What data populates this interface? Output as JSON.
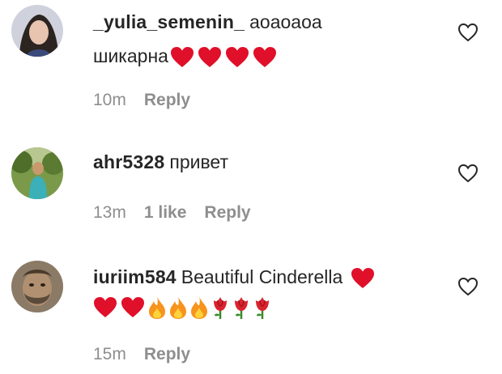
{
  "comments": [
    {
      "username": "_yulia_semenin_",
      "text_line1": "аоаоаоа",
      "text_line2": "шикарна",
      "emoji_line1": [],
      "emoji_line2": [
        "red-heart",
        "red-heart",
        "red-heart",
        "red-heart"
      ],
      "time": "10m",
      "likes": "",
      "reply_label": "Reply",
      "avatar": "user-avatar-woman"
    },
    {
      "username": "ahr5328",
      "text_line1": "привет",
      "time": "13m",
      "likes": "1 like",
      "reply_label": "Reply",
      "avatar": "user-avatar-outdoor"
    },
    {
      "username": "iuriim584",
      "text_line1": "Beautiful Cinderella",
      "emoji_line1": [
        "red-heart"
      ],
      "emoji_line2": [
        "red-heart",
        "red-heart",
        "fire",
        "fire",
        "fire",
        "rose",
        "rose",
        "rose"
      ],
      "time": "15m",
      "reply_label": "Reply",
      "avatar": "user-avatar-man"
    }
  ],
  "colors": {
    "text": "#262626",
    "meta": "#8e8e8e",
    "heart": "#e0102a"
  },
  "icons": {
    "like": "heart-outline-icon"
  }
}
